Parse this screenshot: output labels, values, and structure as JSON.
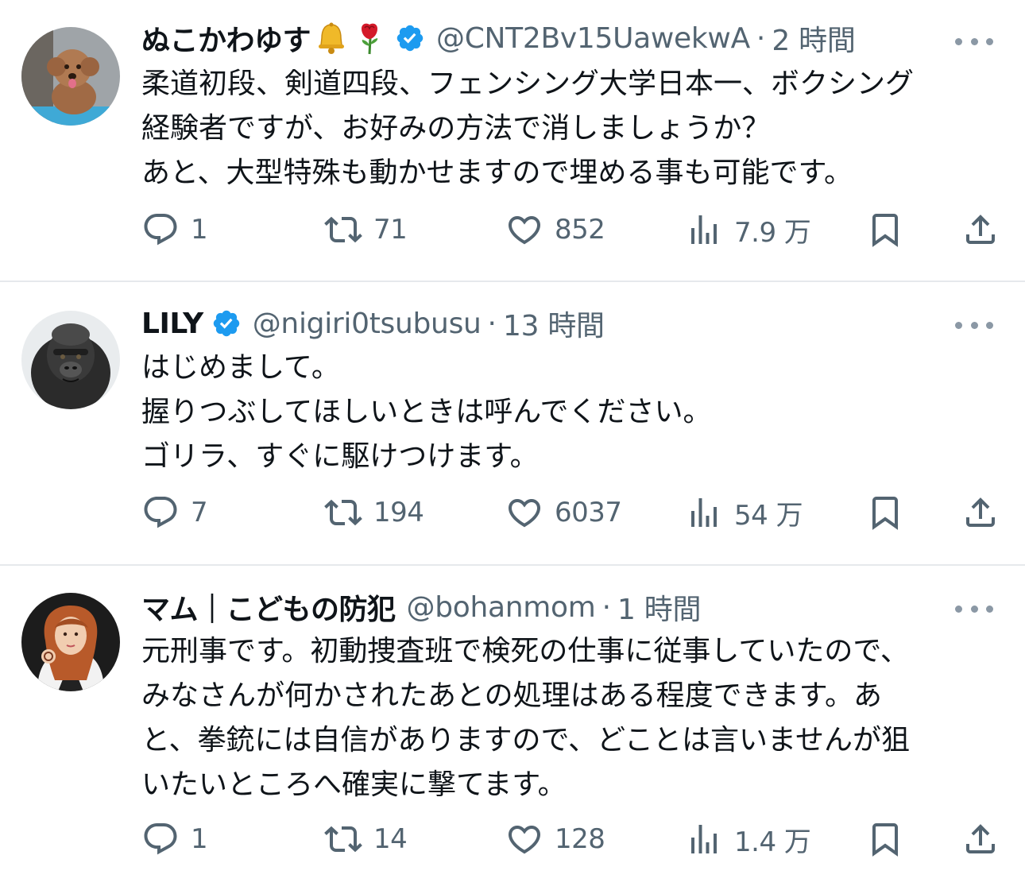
{
  "colors": {
    "text": "#0f1419",
    "secondary": "#536471",
    "verified": "#1d9bf0",
    "divider": "#e6e9ec"
  },
  "tweets": [
    {
      "name": "ぬこかわゆす",
      "emojis": [
        "bell",
        "rose"
      ],
      "verified": true,
      "handle": "@CNT2Bv15UawekwA",
      "separator": "·",
      "time": "2 時間",
      "body": [
        "柔道初段、剣道四段、フェンシング大学日本一、ボクシング",
        "経験者ですが、お好みの方法で消しましょうか？",
        "あと、大型特殊も動かせますので埋める事も可能です。"
      ],
      "avatar": "poodle-avatar",
      "replies": "1",
      "reposts": "71",
      "likes": "852",
      "views": "7.9 万"
    },
    {
      "name": "LILY",
      "emojis": [],
      "verified": true,
      "handle": "@nigiri0tsubusu",
      "separator": "·",
      "time": "13 時間",
      "body": [
        "はじめまして。",
        "握りつぶしてほしいときは呼んでください。",
        "ゴリラ、すぐに駆けつけます。"
      ],
      "avatar": "gorilla-avatar",
      "replies": "7",
      "reposts": "194",
      "likes": "6037",
      "views": "54 万"
    },
    {
      "name": "マム｜こどもの防犯",
      "emojis": [],
      "verified": false,
      "handle": "@bohanmom",
      "separator": "·",
      "time": "1 時間",
      "body": [
        "元刑事です。初動捜査班で検死の仕事に従事していたので、",
        "みなさんが何かされたあとの処理はある程度できます。あ",
        "と、拳銃には自信がありますので、どことは言いませんが狙",
        "いたいところへ確実に撃てます。"
      ],
      "avatar": "woman-illustration-avatar",
      "replies": "1",
      "reposts": "14",
      "likes": "128",
      "views": "1.4 万"
    }
  ]
}
